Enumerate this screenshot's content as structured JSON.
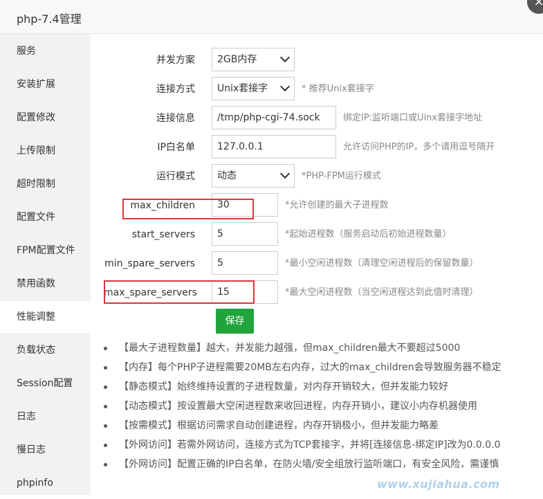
{
  "title": "php-7.4管理",
  "close_glyph": "×",
  "sidebar": {
    "items": [
      {
        "label": "服务"
      },
      {
        "label": "安装扩展"
      },
      {
        "label": "配置修改"
      },
      {
        "label": "上传限制"
      },
      {
        "label": "超时限制"
      },
      {
        "label": "配置文件"
      },
      {
        "label": "FPM配置文件"
      },
      {
        "label": "禁用函数"
      },
      {
        "label": "性能调整"
      },
      {
        "label": "负载状态"
      },
      {
        "label": "Session配置"
      },
      {
        "label": "日志"
      },
      {
        "label": "慢日志"
      },
      {
        "label": "phpinfo"
      }
    ],
    "active": "性能调整"
  },
  "form": {
    "concurrency": {
      "label": "并发方案",
      "value": "2GB内存"
    },
    "connect_mode": {
      "label": "连接方式",
      "value": "Unix套接字",
      "hint": "* 推荐Unix套接字"
    },
    "connect_info": {
      "label": "连接信息",
      "value": "/tmp/php-cgi-74.sock",
      "hint": "绑定IP:监听端口或Uinx套接字地址"
    },
    "ip_whitelist": {
      "label": "IP白名单",
      "value": "127.0.0.1",
      "hint": "允许访问PHP的IP，多个请用逗号隔开"
    },
    "run_mode": {
      "label": "运行模式",
      "value": "动态",
      "hint": "*PHP-FPM运行模式"
    },
    "max_children": {
      "label": "max_children",
      "value": "30",
      "hint": "*允许创建的最大子进程数"
    },
    "start_servers": {
      "label": "start_servers",
      "value": "5",
      "hint": "*起始进程数（服务启动后初始进程数量）"
    },
    "min_spare_servers": {
      "label": "min_spare_servers",
      "value": "5",
      "hint": "*最小空闲进程数（清理空闲进程后的保留数量）"
    },
    "max_spare_servers": {
      "label": "max_spare_servers",
      "value": "15",
      "hint": "*最大空闲进程数（当空闲进程达到此值时清理）"
    },
    "save_label": "保存"
  },
  "tips": [
    "【最大子进程数量】越大，并发能力越强，但max_children最大不要超过5000",
    "【内存】每个PHP子进程需要20MB左右内存，过大的max_children会导致服务器不稳定",
    "【静态模式】始终维持设置的子进程数量，对内存开销较大，但并发能力较好",
    "【动态模式】按设置最大空闲进程数来收回进程，内存开销小，建议小内存机器使用",
    "【按需模式】根据访问需求自动创建进程，内存开销极小，但并发能力略差",
    "【外网访问】若需外网访问，连接方式为TCP套接字，并将[连接信息-绑定IP]改为0.0.0.0",
    "【外网访问】配置正确的IP白名单，在防火墙/安全组放行监听端口，有安全风险，需谨慎"
  ],
  "watermark": "www.xujiahua.com",
  "colors": {
    "accent": "#20a53a",
    "highlight": "#d9363e",
    "sidebar_bg": "#f2f2f2"
  }
}
